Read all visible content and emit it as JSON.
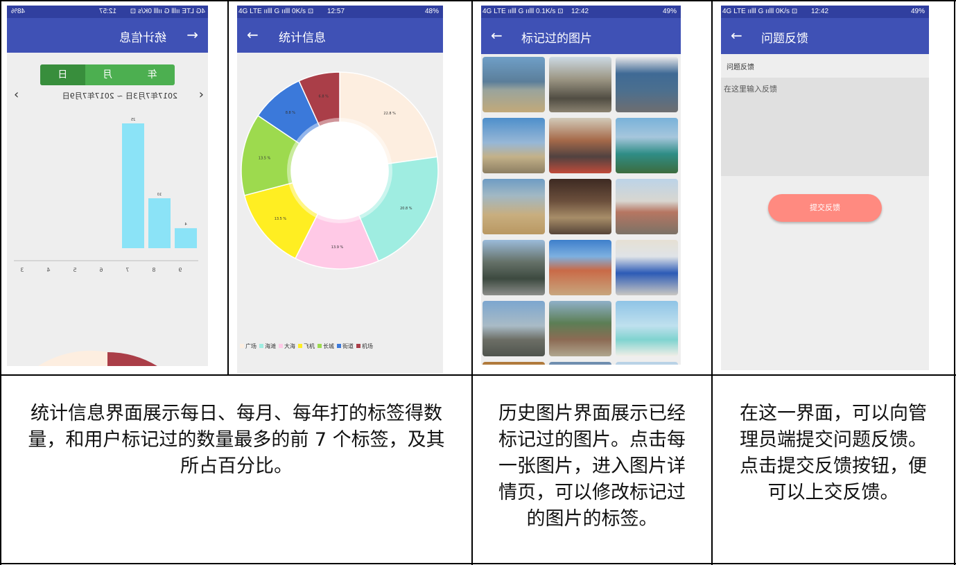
{
  "screen1": {
    "status": {
      "left": "4G LTE ıılll G ıılll 0K/s ⊡",
      "time": "12:57",
      "right": "48%"
    },
    "title": "统计信息",
    "seg": [
      "年",
      "月",
      "日"
    ],
    "range": "2017年7月3日 ~ 2017年7月9日",
    "bars": [
      {
        "label": "9",
        "value": 4
      },
      {
        "label": "8",
        "value": 10
      },
      {
        "label": "7",
        "value": 25
      }
    ],
    "axis": [
      "9",
      "8",
      "7",
      "6",
      "5",
      "4",
      "3"
    ]
  },
  "screen2": {
    "status": {
      "left": "4G LTE ıılll G ıılll 0K/s ⊡",
      "time": "12:57",
      "right": "48%"
    },
    "title": "统计信息",
    "pie": [
      {
        "name": "广场",
        "value": 22.8,
        "label": "22.8 %",
        "color": "#FDEEE0"
      },
      {
        "name": "海滩",
        "value": 20.8,
        "label": "20.8 %",
        "color": "#9FEDE1"
      },
      {
        "name": "大海",
        "value": 13.9,
        "label": "13.9 %",
        "color": "#FFC9E6"
      },
      {
        "name": "飞机",
        "value": 13.5,
        "label": "13.5 %",
        "color": "#FFEE22"
      },
      {
        "name": "长城",
        "value": 13.5,
        "label": "13.5 %",
        "color": "#9DDA4E"
      },
      {
        "name": "街道",
        "value": 8.8,
        "label": "8.8 %",
        "color": "#3B79DA"
      },
      {
        "name": "机场",
        "value": 6.8,
        "label": "6.8 %",
        "color": "#AA3E48"
      }
    ]
  },
  "screen3": {
    "status": {
      "left": "4G LTE ıılll G ıılll 0.1K/s ⊡",
      "time": "12:42",
      "right": "49%"
    },
    "title": "标记过的图片"
  },
  "screen4": {
    "status": {
      "left": "4G LTE ıılll G ıılll 0K/s ⊡",
      "time": "12:42",
      "right": "49%"
    },
    "title": "问题反馈",
    "section_label": "问题反馈",
    "input_placeholder": "在这里输入反馈",
    "submit": "提交反馈"
  },
  "captions": {
    "stats": "统计信息界面展示每日、每月、每年打的标签得数\n量，和用户标记过的数量最多的前 7 个标签，及其\n所占百分比。",
    "history": "历史图片界面展示已经\n标记过的图片。点击每\n一张图片，进入图片详\n情页，可以修改标记过\n的图片的标签。",
    "feedback": "在这一界面，可以向管\n理员端提交问题反馈。\n点击提交反馈按钮，便\n可以上交反馈。"
  },
  "colors": {
    "appbar": "#3F51B5",
    "segment": "#4CAF50",
    "bar": "#8BE3F7",
    "submit": "#FF8A80"
  }
}
